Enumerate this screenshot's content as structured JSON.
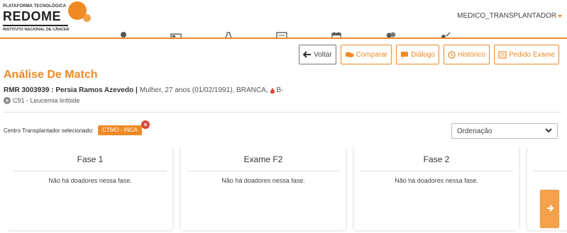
{
  "header": {
    "logo_top": "PLATAFORMA TECNOLÓGICA",
    "logo_main": "REDOME",
    "logo_sub": "INSTITUTO NACIONAL DE CÂNCER",
    "user": "MEDICO_TRANSPLANTADOR",
    "nav_icons": [
      "user-icon",
      "id-card-icon",
      "flask-icon",
      "certificate-icon",
      "calendar-icon",
      "users-icon",
      "settings-icon"
    ]
  },
  "toolbar": {
    "back": "Voltar",
    "compare": "Comparar",
    "dialog": "Diálogo",
    "history": "Histórico",
    "exam_request": "Pedido Exame"
  },
  "page": {
    "title": "Análise De Match"
  },
  "patient": {
    "id": "RMR 3003939 : Persia Ramos Azevedo",
    "separator": "|",
    "details": "Mulher, 27 anos (01/02/1991), BRANCA,",
    "blood": "B-",
    "diagnosis": "C91 - Leucemia linfóide"
  },
  "centro": {
    "label": "Centro Transplantador selecionado:",
    "value": "CTMO - INCA",
    "remove": "×"
  },
  "sort": {
    "label": "Ordenação"
  },
  "phases": [
    {
      "title": "Fase 1",
      "empty": "Não há doadores nessa fase."
    },
    {
      "title": "Exame F2",
      "empty": "Não há doadores nessa fase."
    },
    {
      "title": "Fase 2",
      "empty": "Não há doadores nessa fase."
    }
  ],
  "colors": {
    "accent": "#f08a24",
    "accent_light": "#f5a04a",
    "danger": "#d9463a"
  }
}
